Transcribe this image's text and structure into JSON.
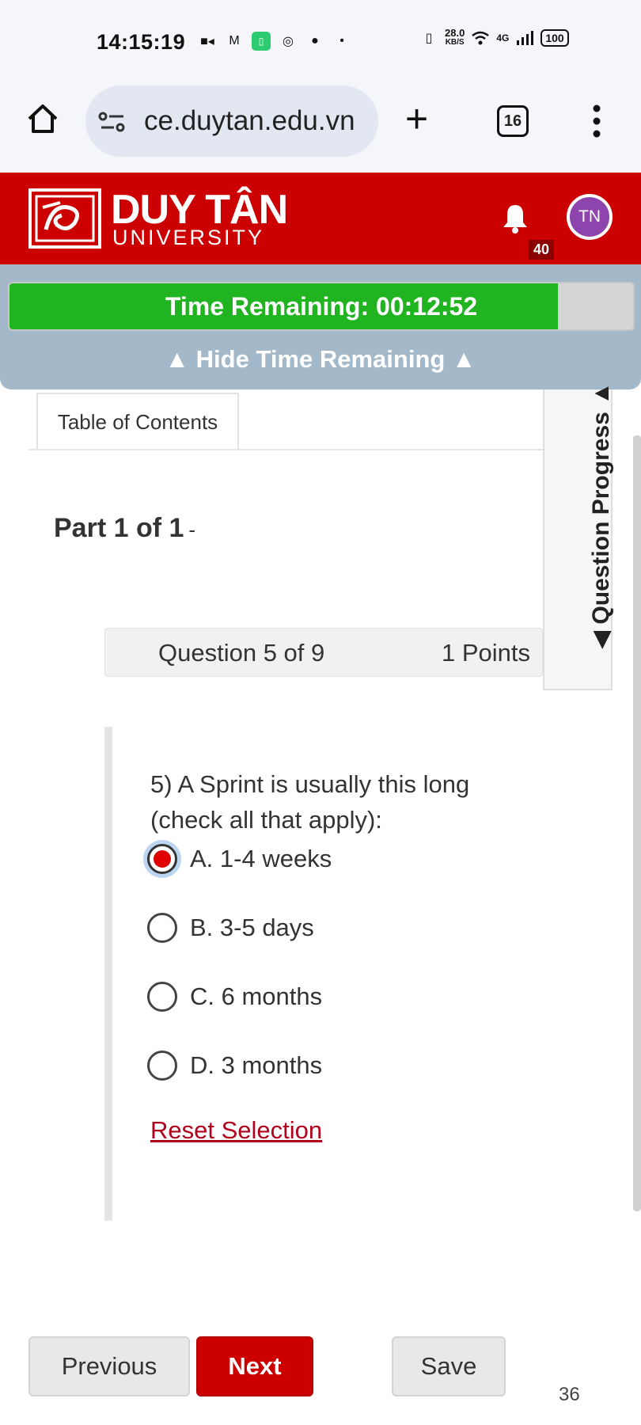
{
  "status_bar": {
    "time": "14:15:19",
    "speed_value": "28.0",
    "speed_unit": "KB/S",
    "network": "4G",
    "battery": "100"
  },
  "browser": {
    "url": "ce.duytan.edu.vn",
    "tab_count": "16"
  },
  "header": {
    "logo_text": "DUY TÂN",
    "logo_subtext": "UNIVERSITY",
    "notification_count": "40",
    "avatar_initials": "TN",
    "brand_color": "#cc0000"
  },
  "timer": {
    "label": "Time Remaining: 00:12:52",
    "fill_fraction": 0.88,
    "toggle_label": "▲ Hide Time Remaining ▲"
  },
  "toc": {
    "label": "Table of Contents"
  },
  "question_progress": {
    "label": "◀ Question Progress ▲"
  },
  "part": {
    "title": "Part 1 of 1",
    "suffix": "-"
  },
  "question": {
    "number_label": "Question 5 of 9",
    "points_label": "1 Points",
    "text": "5) A Sprint is usually this long (check all that apply):",
    "options": [
      {
        "label": "A. 1-4 weeks",
        "selected": true
      },
      {
        "label": "B. 3-5 days",
        "selected": false
      },
      {
        "label": "C. 6 months",
        "selected": false
      },
      {
        "label": "D. 3 months",
        "selected": false
      }
    ],
    "reset_label": "Reset Selection"
  },
  "footer": {
    "previous_label": "Previous",
    "next_label": "Next",
    "save_label": "Save",
    "page_number": "36"
  }
}
